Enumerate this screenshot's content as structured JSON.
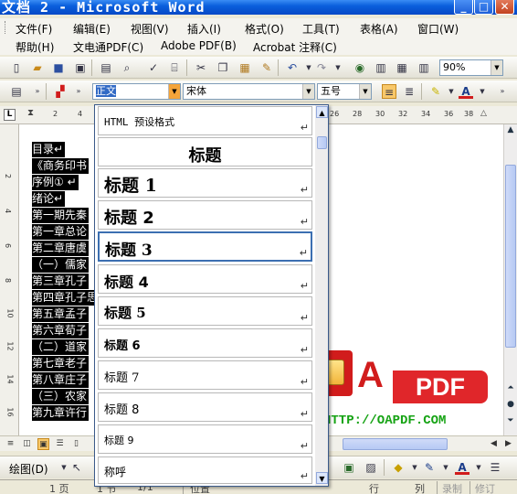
{
  "window": {
    "title": "文档 2 - Microsoft Word",
    "controls": [
      "_",
      "□",
      "✕"
    ]
  },
  "menubar": {
    "items": [
      "文件(F)",
      "编辑(E)",
      "视图(V)",
      "插入(I)",
      "格式(O)",
      "工具(T)",
      "表格(A)",
      "窗口(W)"
    ]
  },
  "menubar2": {
    "items": [
      "帮助(H)",
      "文电通PDF(C)",
      "Adobe PDF(B)",
      "Acrobat 注释(C)"
    ]
  },
  "standard_toolbar": {
    "zoom": "90%"
  },
  "format_toolbar": {
    "style_value": "正文",
    "font_value": "宋体",
    "size_value": "五号"
  },
  "ruler": {
    "ticks_left": [
      "2",
      "4"
    ],
    "ticks_right": [
      "26",
      "28",
      "30",
      "32",
      "34",
      "36",
      "38"
    ]
  },
  "vruler": {
    "ticks": [
      "2",
      "4",
      "6",
      "8",
      "10",
      "12",
      "14",
      "16"
    ]
  },
  "document": {
    "lines": [
      "目录↵",
      "《商务印书",
      "序例① ↵",
      "绪论↵",
      "第一期先秦",
      "第一章总论",
      "第二章唐虞",
      "（一）儒家",
      "第三章孔子",
      "第四章孔子思",
      "第五章孟子",
      "第六章荀子",
      "（二）道家",
      "第七章老子",
      "第八章庄子",
      "（三）农家",
      "第九章许行"
    ]
  },
  "style_dropdown": {
    "items": [
      {
        "label": "HTML 预设格式",
        "key": "html-preformatted"
      },
      {
        "label": "标题",
        "key": "title"
      },
      {
        "label": "标题 1",
        "key": "heading-1"
      },
      {
        "label": "标题 2",
        "key": "heading-2"
      },
      {
        "label": "标题 3",
        "key": "heading-3"
      },
      {
        "label": "标题 4",
        "key": "heading-4"
      },
      {
        "label": "标题 5",
        "key": "heading-5"
      },
      {
        "label": "标题 6",
        "key": "heading-6"
      },
      {
        "label": "标题 7",
        "key": "heading-7"
      },
      {
        "label": "标题 8",
        "key": "heading-8"
      },
      {
        "label": "标题 9",
        "key": "heading-9"
      },
      {
        "label": "称呼",
        "key": "salutation"
      }
    ],
    "pilcrow": "↵"
  },
  "watermark": {
    "letter": "A",
    "brand": "PDF",
    "url": "HTTP://OAPDF.COM"
  },
  "drawing_toolbar": {
    "label": "绘图(D)"
  },
  "statusbar": {
    "page": "1 页",
    "section": "1 节",
    "pages": "1/1",
    "position": "位置",
    "line": "行",
    "column": "列",
    "rec": "录制",
    "trk": "修订"
  },
  "colors": {
    "titlebar": "#0a5fdc",
    "accent_red": "#d11c1c",
    "watermark_url": "#16a314"
  }
}
